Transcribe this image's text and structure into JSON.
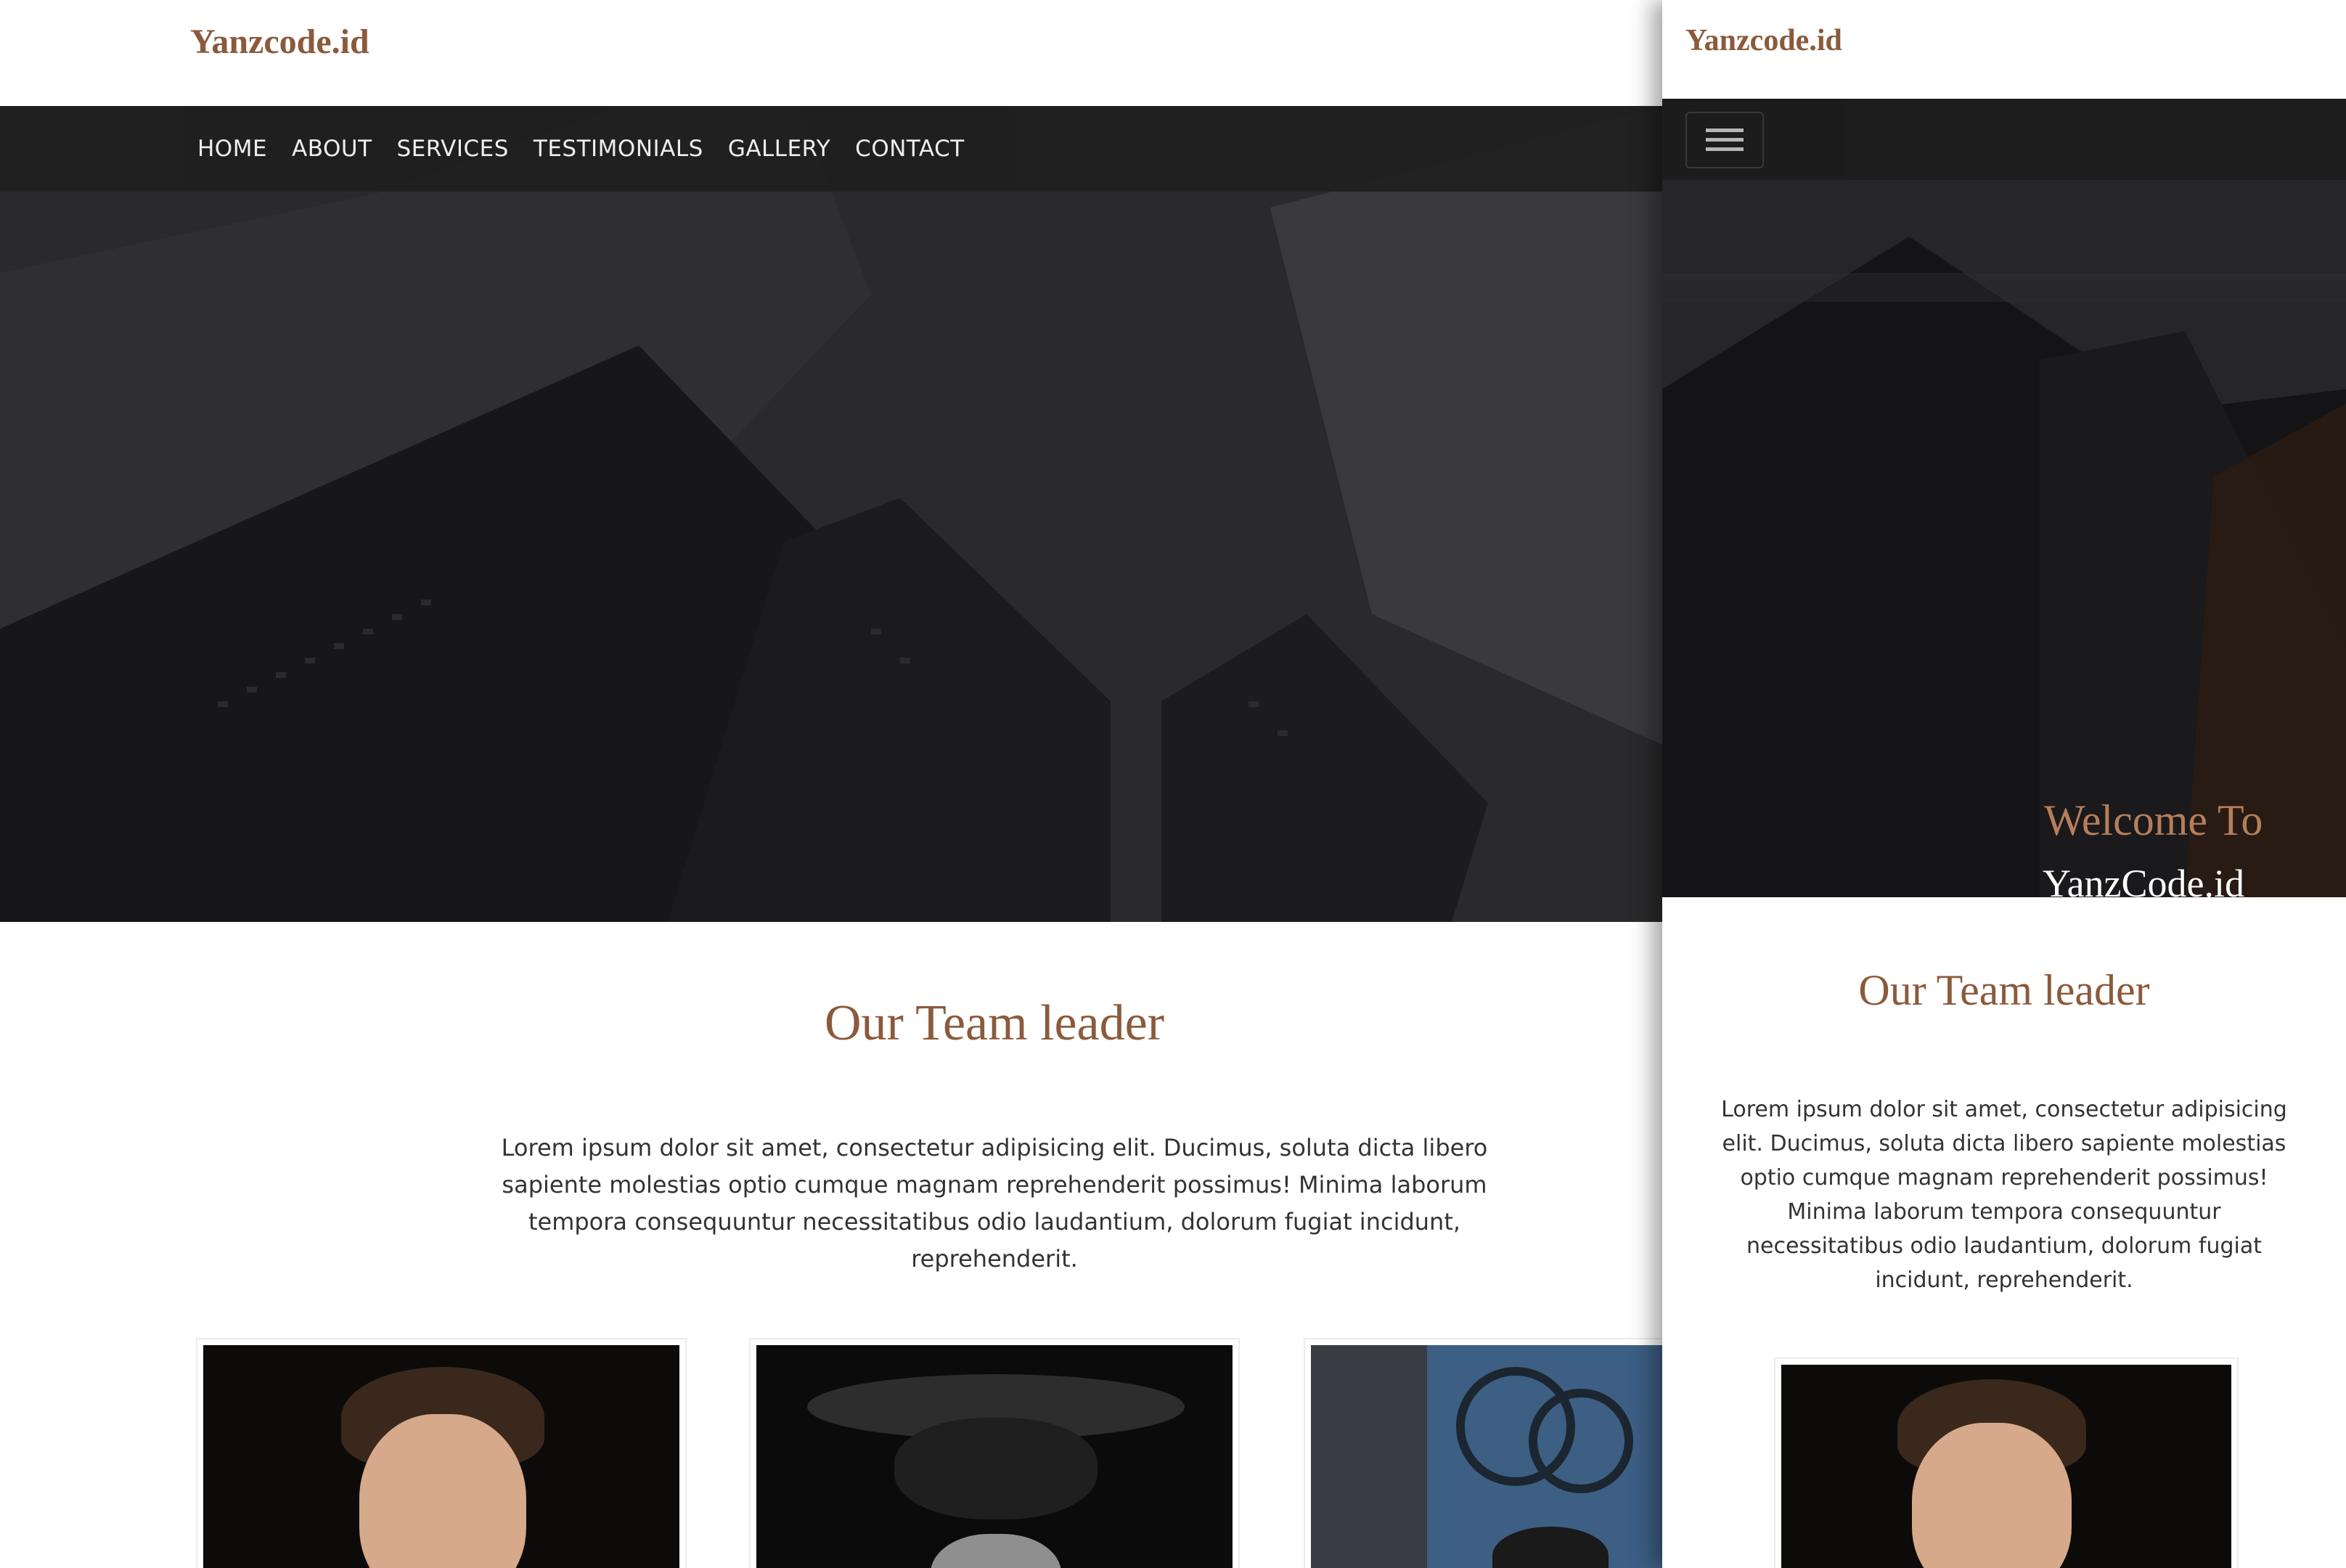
{
  "desktop": {
    "brand": "Yanzcode.id",
    "nav": [
      "HOME",
      "ABOUT",
      "SERVICES",
      "TESTIMONIALS",
      "GALLERY",
      "CONTACT"
    ],
    "team": {
      "title": "Our Team leader",
      "text": "Lorem ipsum dolor sit amet, consectetur adipisicing elit. Ducimus, soluta dicta libero sapiente molestias optio cumque magnam reprehenderit possimus! Minima laborum tempora consequuntur necessitatibus odio laudantium, dolorum fugiat incidunt, reprehenderit."
    }
  },
  "mobile": {
    "brand": "Yanzcode.id",
    "hero": {
      "line1": "Welcome To",
      "line2": "YanzCode.id"
    },
    "team": {
      "title": "Our Team leader",
      "text": "Lorem ipsum dolor sit amet, consectetur adipisicing elit. Ducimus, soluta dicta libero sapiente molestias optio cumque magnam reprehenderit possimus! Minima laborum tempora consequuntur necessitatibus odio laudantium, dolorum fugiat incidunt, reprehenderit."
    }
  },
  "colors": {
    "brand": "#8b5a3c",
    "nav_bg": "#1f1f20",
    "welcome": "#b77e5a"
  },
  "icons": {
    "menu": "hamburger-menu-icon"
  }
}
